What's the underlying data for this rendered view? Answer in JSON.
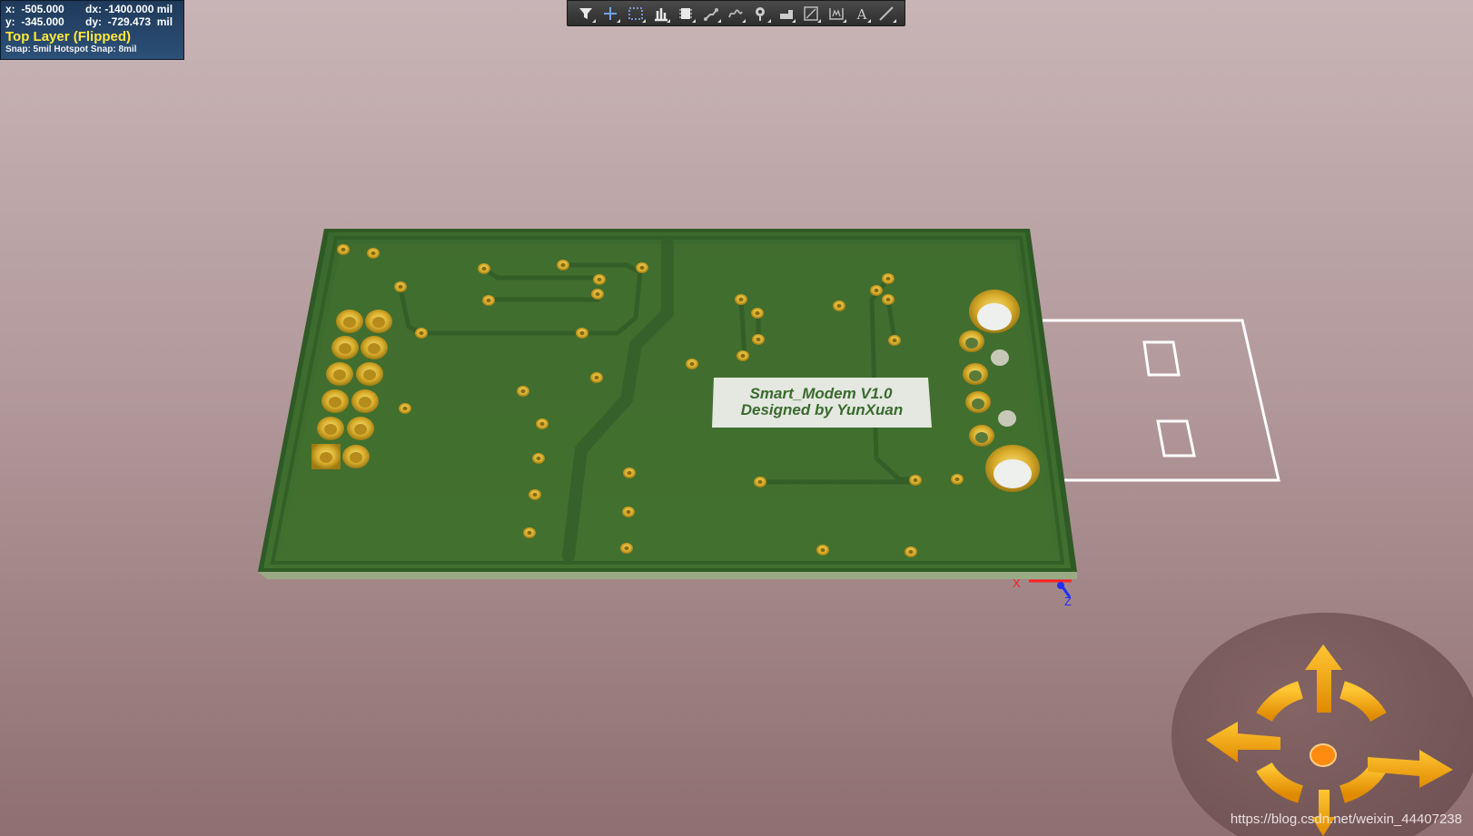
{
  "hud": {
    "x_label": "x:  -505.000",
    "dx_label": "dx: -1400.000 mil",
    "y_label": "y:  -345.000",
    "dy_label": "dy:  -729.473  mil",
    "layer": "Top Layer (Flipped)",
    "snap": "Snap: 5mil Hotspot Snap: 8mil"
  },
  "toolbar": {
    "tools": [
      {
        "name": "filter-tool",
        "icon": "filter-icon"
      },
      {
        "name": "place-cross-tool",
        "icon": "cross-icon"
      },
      {
        "name": "select-area-tool",
        "icon": "select-rect-icon"
      },
      {
        "name": "align-tool",
        "icon": "align-icon"
      },
      {
        "name": "component-tool",
        "icon": "component-icon"
      },
      {
        "name": "route-tool",
        "icon": "route-icon"
      },
      {
        "name": "diff-pair-tool",
        "icon": "diff-pair-icon"
      },
      {
        "name": "via-tool",
        "icon": "via-icon"
      },
      {
        "name": "fill-tool",
        "icon": "fill-icon"
      },
      {
        "name": "dimension-tool",
        "icon": "dimension-icon"
      },
      {
        "name": "room-tool",
        "icon": "room-icon"
      },
      {
        "name": "text-tool",
        "icon": "text-icon"
      },
      {
        "name": "line-tool",
        "icon": "line-icon"
      }
    ]
  },
  "board": {
    "silk_line1": "Smart_Modem V1.0",
    "silk_line2": "Designed by YunXuan",
    "board_color": "#3f6b2e",
    "pad_color": "#d9b434"
  },
  "axes": {
    "x_label": "X",
    "z_label": "Z"
  },
  "watermark": "https://blog.csdn.net/weixin_44407238"
}
